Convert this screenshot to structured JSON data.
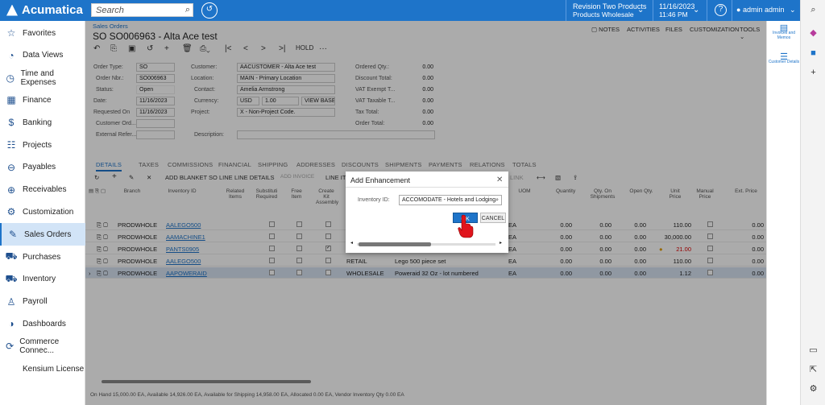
{
  "topbar": {
    "logo": "Acumatica",
    "search_placeholder": "Search",
    "branch_line1": "Revision Two Products",
    "branch_line2": "Products Wholesale",
    "date": "11/16/2023",
    "time": "11:46 PM",
    "user": "admin admin"
  },
  "sidebar": {
    "items": [
      {
        "label": "Favorites",
        "icon": "star-icon"
      },
      {
        "label": "Data Views",
        "icon": "chart-icon"
      },
      {
        "label": "Time and Expenses",
        "icon": "clock-icon"
      },
      {
        "label": "Finance",
        "icon": "calculator-icon"
      },
      {
        "label": "Banking",
        "icon": "dollar-icon"
      },
      {
        "label": "Projects",
        "icon": "projects-icon"
      },
      {
        "label": "Payables",
        "icon": "minus-circle-icon"
      },
      {
        "label": "Receivables",
        "icon": "plus-circle-icon"
      },
      {
        "label": "Customization",
        "icon": "gear-icon"
      },
      {
        "label": "Sales Orders",
        "icon": "edit-icon"
      },
      {
        "label": "Purchases",
        "icon": "cart-icon"
      },
      {
        "label": "Inventory",
        "icon": "truck-icon"
      },
      {
        "label": "Payroll",
        "icon": "person-icon"
      },
      {
        "label": "Dashboards",
        "icon": "dashboard-icon"
      },
      {
        "label": "Commerce Connec...",
        "icon": "sync-icon"
      },
      {
        "label": "Kensium License",
        "icon": ""
      }
    ]
  },
  "page": {
    "breadcrumb": "Sales Orders",
    "title": "SO SO006963 - Alta Ace test",
    "tools": [
      "NOTES",
      "ACTIVITIES",
      "FILES",
      "CUSTOMIZATION",
      "TOOLS"
    ],
    "hold": "HOLD"
  },
  "form": {
    "order_type_label": "Order Type:",
    "order_type": "SO",
    "order_nbr_label": "Order Nbr.:",
    "order_nbr": "SO006963",
    "status_label": "Status:",
    "status": "Open",
    "date_label": "Date:",
    "date": "11/16/2023",
    "requested_on_label": "Requested On",
    "requested_on": "11/16/2023",
    "customer_ord_label": "Customer Ord...",
    "external_ref_label": "External Refer...",
    "customer_label": "Customer:",
    "customer": "AACUSTOMER - Alta Ace test",
    "location_label": "Location:",
    "location": "MAIN - Primary Location",
    "contact_label": "Contact:",
    "contact": "Amelia Armstrong",
    "currency_label": "Currency:",
    "currency": "USD",
    "rate": "1.00",
    "view_base": "VIEW BASE",
    "project_label": "Project:",
    "project": "X - Non-Project Code.",
    "description_label": "Description:",
    "totals": [
      {
        "label": "Ordered Qty.:",
        "value": "0.00"
      },
      {
        "label": "Discount Total:",
        "value": "0.00"
      },
      {
        "label": "VAT Exempt T...",
        "value": "0.00"
      },
      {
        "label": "VAT Taxable T...",
        "value": "0.00"
      },
      {
        "label": "Tax Total:",
        "value": "0.00"
      },
      {
        "label": "Order Total:",
        "value": "0.00"
      }
    ]
  },
  "tabs": [
    "DETAILS",
    "TAXES",
    "COMMISSIONS",
    "FINANCIAL",
    "SHIPPING",
    "ADDRESSES",
    "DISCOUNTS",
    "SHIPMENTS",
    "PAYMENTS",
    "RELATIONS",
    "TOTALS"
  ],
  "grid_toolbar": {
    "add_blanket": "ADD BLANKET SO LINE",
    "line_details": "LINE DETAILS",
    "add_invoice": "ADD INVOICE",
    "line_it": "LINE IT",
    "link": "LINK"
  },
  "grid": {
    "headers": [
      "Branch",
      "Inventory ID",
      "Related Items",
      "Substituti Required",
      "Free Item",
      "Create Kit Assembly",
      "UOM",
      "Quantity",
      "Qty. On Shipments",
      "Open Qty.",
      "Unit Price",
      "Manual Price",
      "Ext. Price"
    ],
    "rows": [
      {
        "branch": "PRODWHOLE",
        "inventory": "AALEGO500",
        "warehouse": "",
        "desc": "",
        "uom": "EA",
        "qty": "0.00",
        "shipqty": "0.00",
        "open": "0.00",
        "price": "110.00",
        "ext": "0.00"
      },
      {
        "branch": "PRODWHOLE",
        "inventory": "AAMACHINE1",
        "warehouse": "",
        "desc": "",
        "uom": "EA",
        "qty": "0.00",
        "shipqty": "0.00",
        "open": "0.00",
        "price": "30,000.00",
        "ext": "0.00"
      },
      {
        "branch": "PRODWHOLE",
        "inventory": "PANTS0905",
        "warehouse": "",
        "desc": "",
        "uom": "EA",
        "qty": "0.00",
        "shipqty": "0.00",
        "open": "0.00",
        "price": "21.00",
        "ext": "0.00"
      },
      {
        "branch": "PRODWHOLE",
        "inventory": "AALEGO500",
        "warehouse": "RETAIL",
        "desc": "Lego 500 piece set",
        "uom": "EA",
        "qty": "0.00",
        "shipqty": "0.00",
        "open": "0.00",
        "price": "110.00",
        "ext": "0.00"
      },
      {
        "branch": "PRODWHOLE",
        "inventory": "AAPOWERAID",
        "warehouse": "WHOLESALE",
        "desc": "Poweraid 32 Oz - lot numbered",
        "uom": "EA",
        "qty": "0.00",
        "shipqty": "0.00",
        "open": "0.00",
        "price": "1.12",
        "ext": "0.00"
      }
    ]
  },
  "status_bar": "On Hand 15,000.00 EA, Available 14,926.00 EA, Available for Shipping 14,958.00 EA, Allocated 0.00 EA, Vendor Inventory Qty 0.00 EA",
  "dialog": {
    "title": "Add Enhancement",
    "inventory_label": "Inventory ID:",
    "inventory_value": "ACCOMODATE - Hotels and Lodging",
    "ok": "OK",
    "cancel": "CANCEL"
  },
  "right_panel": {
    "invoices": "Invoices and Memos",
    "customer": "Customer Details"
  },
  "colors": {
    "accent": "#1e74c9",
    "pointer": "#e0141c"
  }
}
